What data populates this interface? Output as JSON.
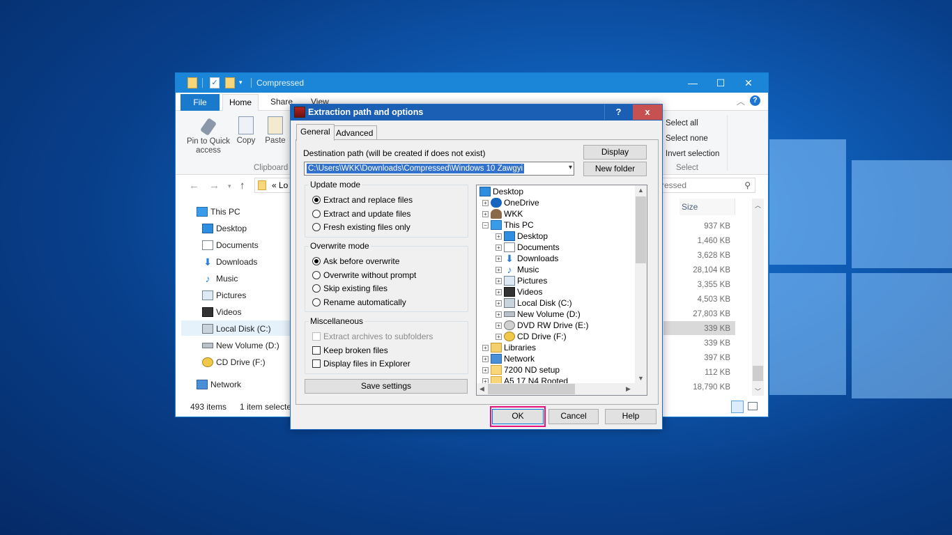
{
  "explorer": {
    "title": "Compressed",
    "tabs": {
      "file": "File",
      "home": "Home",
      "share": "Share",
      "view": "View"
    },
    "ribbon": {
      "pin": "Pin to Quick access",
      "copy": "Copy",
      "paste": "Paste",
      "clipboard_group": "Clipboard",
      "select_all": "Select all",
      "select_none": "Select none",
      "invert_selection": "Invert selection",
      "select_group": "Select"
    },
    "address_text": "« Lo",
    "search_text": "ressed",
    "sidebar": [
      {
        "label": "This PC",
        "icon": "monitor-icon"
      },
      {
        "label": "Desktop",
        "icon": "desktop-icon"
      },
      {
        "label": "Documents",
        "icon": "documents-icon"
      },
      {
        "label": "Downloads",
        "icon": "download-arrow-icon"
      },
      {
        "label": "Music",
        "icon": "music-note-icon"
      },
      {
        "label": "Pictures",
        "icon": "pictures-icon"
      },
      {
        "label": "Videos",
        "icon": "videos-icon"
      },
      {
        "label": "Local Disk (C:)",
        "icon": "local-disk-icon"
      },
      {
        "label": "New Volume (D:)",
        "icon": "drive-icon"
      },
      {
        "label": "CD Drive (F:)",
        "icon": "cd-drive-icon"
      },
      {
        "label": "Network",
        "icon": "network-icon"
      }
    ],
    "size_header": "Size",
    "sizes": [
      "937 KB",
      "1,460 KB",
      "3,628 KB",
      "28,104 KB",
      "3,355 KB",
      "4,503 KB",
      "27,803 KB",
      "339 KB",
      "339 KB",
      "397 KB",
      "112 KB",
      "18,790 KB"
    ],
    "status_count": "493 items",
    "status_selected": "1 item selecte"
  },
  "dialog": {
    "title": "Extraction path and options",
    "help_glyph": "?",
    "close_glyph": "x",
    "tabs": {
      "general": "General",
      "advanced": "Advanced"
    },
    "dest_label": "Destination path (will be created if does not exist)",
    "dest_value": "C:\\Users\\WKK\\Downloads\\Compressed\\Windows 10 Zawgyi",
    "display_btn": "Display",
    "new_folder_btn": "New folder",
    "update_mode": {
      "title": "Update mode",
      "options": [
        "Extract and replace files",
        "Extract and update files",
        "Fresh existing files only"
      ],
      "selected": 0
    },
    "overwrite_mode": {
      "title": "Overwrite mode",
      "options": [
        "Ask before overwrite",
        "Overwrite without prompt",
        "Skip existing files",
        "Rename automatically"
      ],
      "selected": 0
    },
    "misc": {
      "title": "Miscellaneous",
      "options": [
        "Extract archives to subfolders",
        "Keep broken files",
        "Display files in Explorer"
      ]
    },
    "save_settings_btn": "Save settings",
    "tree": [
      {
        "label": "Desktop",
        "icon": "desktop-icon",
        "level": 0,
        "exp": ""
      },
      {
        "label": "OneDrive",
        "icon": "cloud-icon",
        "level": 1,
        "exp": "+"
      },
      {
        "label": "WKK",
        "icon": "user-icon",
        "level": 1,
        "exp": "+"
      },
      {
        "label": "This PC",
        "icon": "monitor-icon",
        "level": 1,
        "exp": "-"
      },
      {
        "label": "Desktop",
        "icon": "desktop-icon",
        "level": 2,
        "exp": "+"
      },
      {
        "label": "Documents",
        "icon": "documents-icon",
        "level": 2,
        "exp": "+"
      },
      {
        "label": "Downloads",
        "icon": "download-arrow-icon",
        "level": 2,
        "exp": "+"
      },
      {
        "label": "Music",
        "icon": "music-note-icon",
        "level": 2,
        "exp": "+"
      },
      {
        "label": "Pictures",
        "icon": "pictures-icon",
        "level": 2,
        "exp": "+"
      },
      {
        "label": "Videos",
        "icon": "videos-icon",
        "level": 2,
        "exp": "+"
      },
      {
        "label": "Local Disk (C:)",
        "icon": "local-disk-icon",
        "level": 2,
        "exp": "+"
      },
      {
        "label": "New Volume (D:)",
        "icon": "drive-icon",
        "level": 2,
        "exp": "+"
      },
      {
        "label": "DVD RW Drive (E:)",
        "icon": "dvd-drive-icon",
        "level": 2,
        "exp": "+"
      },
      {
        "label": "CD Drive (F:)",
        "icon": "cd-drive-icon",
        "level": 2,
        "exp": "+"
      },
      {
        "label": "Libraries",
        "icon": "libraries-icon",
        "level": 1,
        "exp": "+"
      },
      {
        "label": "Network",
        "icon": "network-icon",
        "level": 1,
        "exp": "+"
      },
      {
        "label": "7200 ND setup",
        "icon": "folder-icon",
        "level": 1,
        "exp": "+"
      },
      {
        "label": "A5 17 N4 Rooted",
        "icon": "folder-icon",
        "level": 1,
        "exp": "+"
      }
    ],
    "ok_btn": "OK",
    "cancel_btn": "Cancel",
    "help_btn": "Help",
    "colors": {
      "title_bar": "#1a5fb4",
      "close": "#c75050",
      "highlight": "#e4127f",
      "selection": "#3372cc"
    }
  }
}
